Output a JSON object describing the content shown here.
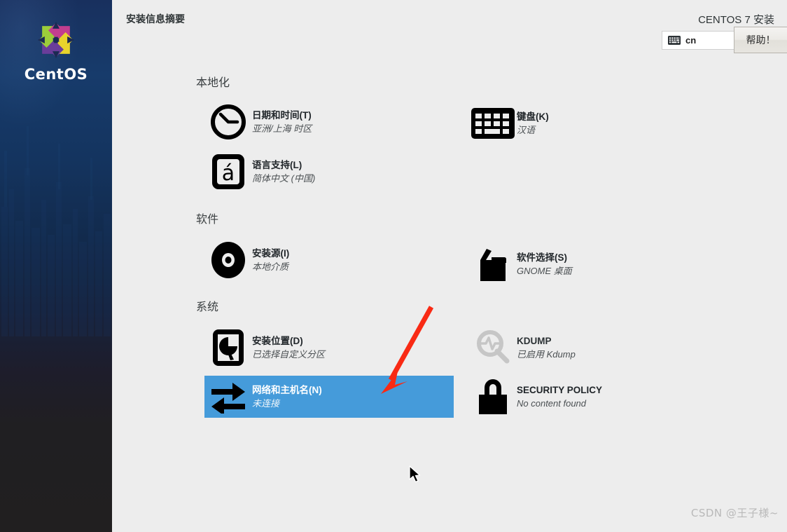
{
  "window": {
    "header_title": "安装信息摘要",
    "product_title": "CENTOS 7 安装"
  },
  "branding": {
    "logo_text": "CentOS",
    "logo_icon": "centos-logo-icon"
  },
  "header": {
    "keyboard_indicator": {
      "icon": "keyboard-icon",
      "layout": "cn"
    },
    "help_button": "帮助！"
  },
  "sections": [
    {
      "id": "localization",
      "title": "本地化",
      "items": [
        {
          "id": "date-time",
          "icon": "clock-icon",
          "title": "日期和时间(T)",
          "subtitle": "亚洲/上海 时区",
          "selected": false,
          "disabled": false
        },
        {
          "id": "keyboard",
          "icon": "keyboard-icon",
          "title": "键盘(K)",
          "subtitle": "汉语",
          "selected": false,
          "disabled": false
        },
        {
          "id": "language-support",
          "icon": "language-icon",
          "title": "语言支持(L)",
          "subtitle": "简体中文 (中国)",
          "selected": false,
          "disabled": false
        }
      ]
    },
    {
      "id": "software",
      "title": "软件",
      "items": [
        {
          "id": "installation-source",
          "icon": "disc-icon",
          "title": "安装源(I)",
          "subtitle": "本地介质",
          "selected": false,
          "disabled": false
        },
        {
          "id": "software-selection",
          "icon": "package-icon",
          "title": "软件选择(S)",
          "subtitle": "GNOME 桌面",
          "selected": false,
          "disabled": false
        }
      ]
    },
    {
      "id": "system",
      "title": "系统",
      "items": [
        {
          "id": "installation-destination",
          "icon": "harddrive-icon",
          "title": "安装位置(D)",
          "subtitle": "已选择自定义分区",
          "selected": false,
          "disabled": false
        },
        {
          "id": "kdump",
          "icon": "magnifier-icon",
          "title": "KDUMP",
          "subtitle": "已启用 Kdump",
          "selected": false,
          "disabled": true
        },
        {
          "id": "network-hostname",
          "icon": "network-arrows-icon",
          "title": "网络和主机名(N)",
          "subtitle": "未连接",
          "selected": true,
          "disabled": false
        },
        {
          "id": "security-policy",
          "icon": "lock-icon",
          "title": "SECURITY POLICY",
          "subtitle": "No content found",
          "selected": false,
          "disabled": false
        }
      ]
    }
  ],
  "annotation": {
    "arrow_color": "#f92a14",
    "points_at": "网络和主机名(N)"
  },
  "watermark": "CSDN @王子様~",
  "colors": {
    "selection_blue": "#459bda",
    "page_background": "#ededed",
    "sidebar_top": "#18305e",
    "sidebar_bottom": "#211f20",
    "icon_black": "#000000",
    "icon_disabled_gray": "#c6c6c6"
  }
}
